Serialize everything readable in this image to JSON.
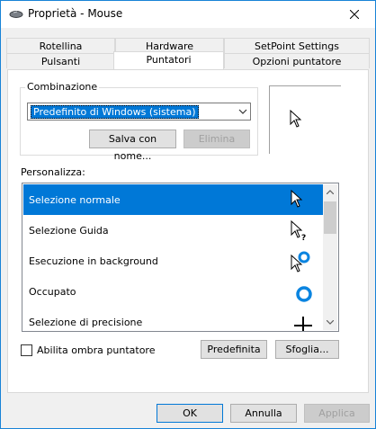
{
  "window": {
    "title": "Proprietà - Mouse"
  },
  "tabs_row1": [
    "Rotellina",
    "Hardware",
    "SetPoint Settings"
  ],
  "tabs_row2": [
    "Pulsanti",
    "Puntatori",
    "Opzioni puntatore"
  ],
  "active_tab": "Puntatori",
  "scheme": {
    "group_label": "Combinazione",
    "selected": "Predefinito di Windows (sistema)",
    "save_button": "Salva con nome...",
    "delete_button": "Elimina"
  },
  "customize": {
    "label": "Personalizza:",
    "items": [
      {
        "label": "Selezione normale",
        "icon": "arrow-cursor-icon",
        "selected": true
      },
      {
        "label": "Selezione Guida",
        "icon": "help-cursor-icon",
        "selected": false
      },
      {
        "label": "Esecuzione in background",
        "icon": "working-in-background-cursor-icon",
        "selected": false
      },
      {
        "label": "Occupato",
        "icon": "busy-cursor-icon",
        "selected": false
      },
      {
        "label": "Selezione di precisione",
        "icon": "precision-cursor-icon",
        "selected": false
      }
    ]
  },
  "shadow_checkbox": {
    "label": "Abilita ombra puntatore",
    "checked": false
  },
  "default_button": "Predefinita",
  "browse_button": "Sfoglia...",
  "footer": {
    "ok": "OK",
    "cancel": "Annulla",
    "apply": "Applica"
  },
  "colors": {
    "accent": "#0078d7",
    "window_border": "#1883d7"
  }
}
